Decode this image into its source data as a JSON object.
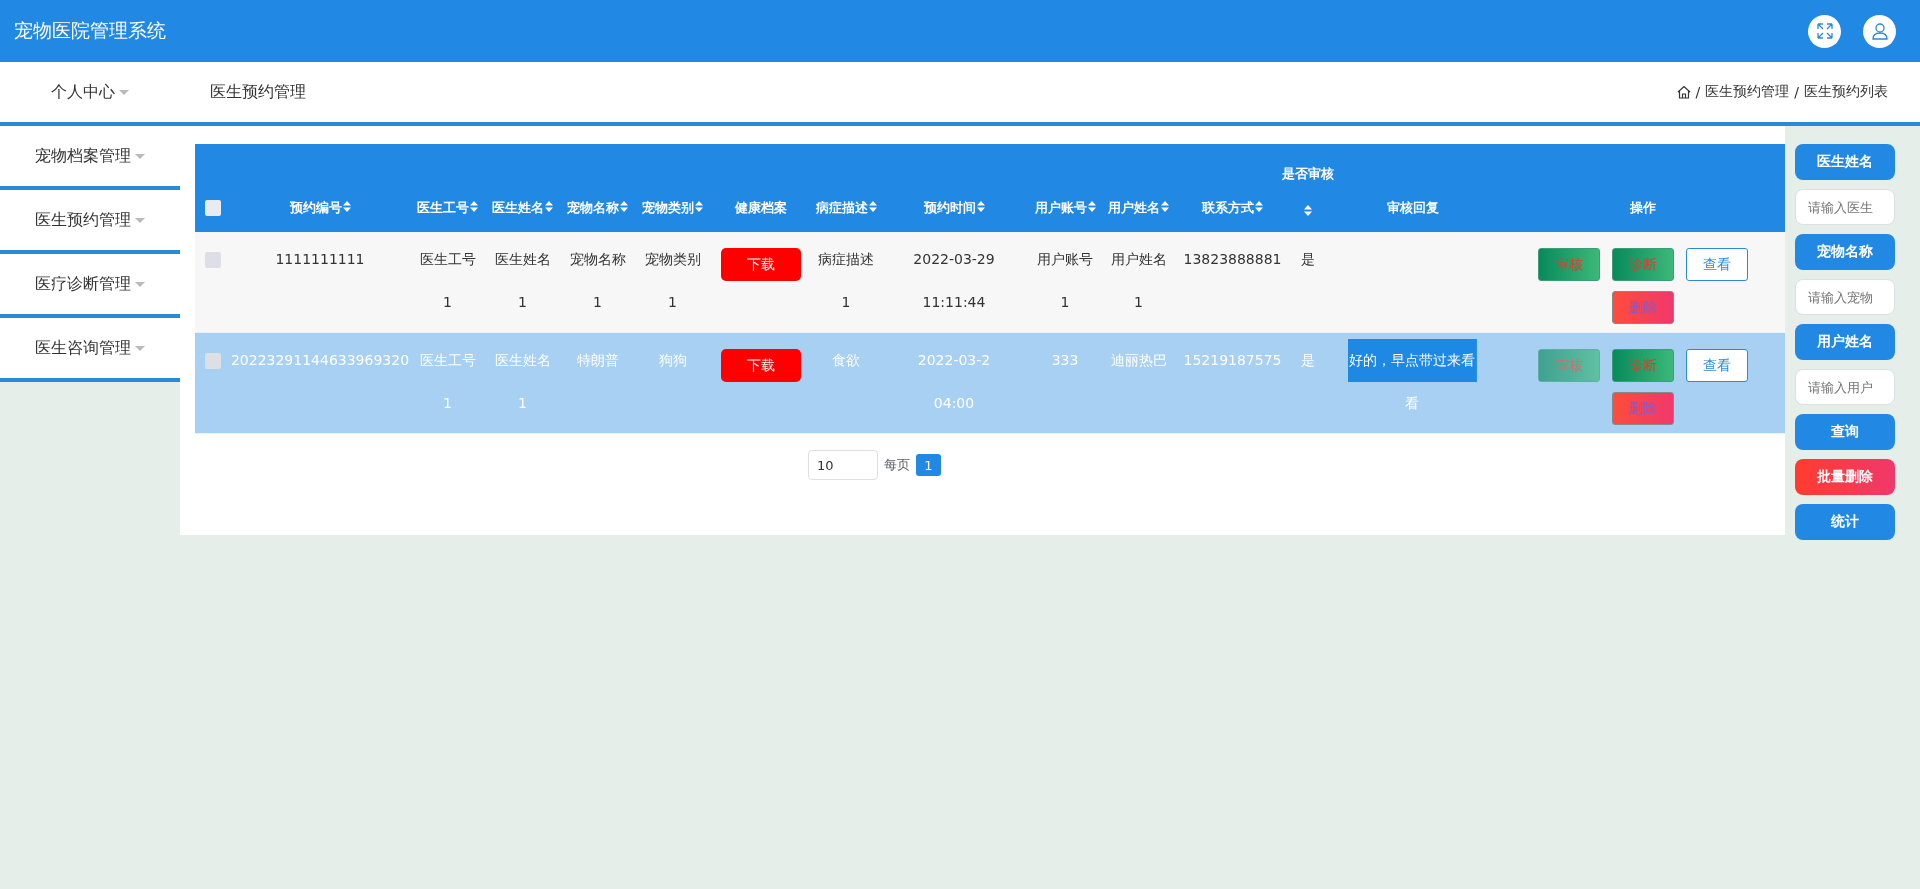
{
  "app_title": "宠物医院管理系统",
  "nav": {
    "menu": "个人中心",
    "page_title": "医生预约管理",
    "separator": "/",
    "breadcrumb": [
      "医生预约管理",
      "医生预约列表"
    ]
  },
  "sidebar": {
    "items": [
      {
        "label": "宠物档案管理"
      },
      {
        "label": "医生预约管理"
      },
      {
        "label": "医疗诊断管理"
      },
      {
        "label": "医生咨询管理"
      }
    ]
  },
  "table": {
    "select_all": {
      "checked": false
    },
    "columns": [
      {
        "kind": "text",
        "label": "预约编号",
        "sortable": true
      },
      {
        "kind": "text",
        "label": "医生工号",
        "sortable": true
      },
      {
        "kind": "text",
        "label": "医生姓名",
        "sortable": true
      },
      {
        "kind": "text",
        "label": "宠物名称",
        "sortable": true
      },
      {
        "kind": "text",
        "label": "宠物类别",
        "sortable": true
      },
      {
        "kind": "file",
        "label": "健康档案",
        "sortable": false
      },
      {
        "kind": "text",
        "label": "病症描述",
        "sortable": true
      },
      {
        "kind": "text",
        "label": "预约时间",
        "sortable": true
      },
      {
        "kind": "text",
        "label": "用户账号",
        "sortable": true
      },
      {
        "kind": "text",
        "label": "用户姓名",
        "sortable": true
      },
      {
        "kind": "text",
        "label": "联系方式",
        "sortable": true
      },
      {
        "kind": "text",
        "label": "是否审核",
        "sortable": true,
        "label_above": true
      },
      {
        "kind": "reply",
        "label": "审核回复",
        "sortable": false
      },
      {
        "kind": "actions",
        "label": "操作",
        "sortable": false
      }
    ],
    "rows": [
      {
        "selected": false,
        "checked": false,
        "reply_highlighted": false,
        "cells": [
          "1111111111",
          "医生工号\n1",
          "医生姓名\n1",
          "宠物名称\n1",
          "宠物类别\n1",
          "下载",
          "病症描述\n1",
          "2022-03-29\n11:11:44",
          "用户账号\n1",
          "用户姓名\n1",
          "13823888881",
          "是",
          ""
        ],
        "actions": [
          {
            "label": "审核",
            "kind": "review",
            "disabled": false
          },
          {
            "label": "诊断",
            "kind": "diagnose",
            "disabled": false
          },
          {
            "label": "查看",
            "kind": "view",
            "disabled": false
          },
          {
            "label": "删除",
            "kind": "delete",
            "disabled": false
          }
        ]
      },
      {
        "selected": true,
        "checked": false,
        "reply_highlighted": true,
        "cells": [
          "20223291144633969320",
          "医生工号\n1",
          "医生姓名\n1",
          "特朗普",
          "狗狗",
          "下载",
          "食欲",
          "2022-03-2\n04:00",
          "333",
          "迪丽热巴",
          "15219187575",
          "是",
          "好的，早点带过来看看"
        ],
        "actions": [
          {
            "label": "审核",
            "kind": "review",
            "disabled": true
          },
          {
            "label": "诊断",
            "kind": "diagnose",
            "disabled": false
          },
          {
            "label": "查看",
            "kind": "view",
            "disabled": false
          },
          {
            "label": "删除",
            "kind": "delete",
            "disabled": false
          }
        ]
      }
    ]
  },
  "pagination": {
    "page_size": "10",
    "unit": "每页",
    "pages": [
      {
        "label": "1",
        "selected": true
      }
    ]
  },
  "search_panel": {
    "items": [
      {
        "kind": "label",
        "text": "医生姓名"
      },
      {
        "kind": "field",
        "placeholder": "请输入医生"
      },
      {
        "kind": "label",
        "text": "宠物名称"
      },
      {
        "kind": "field",
        "placeholder": "请输入宠物"
      },
      {
        "kind": "label",
        "text": "用户姓名"
      },
      {
        "kind": "field",
        "placeholder": "请输入用户"
      },
      {
        "kind": "button",
        "text": "查询"
      },
      {
        "kind": "danger",
        "text": "批量删除"
      },
      {
        "kind": "button",
        "text": "统计"
      }
    ]
  }
}
